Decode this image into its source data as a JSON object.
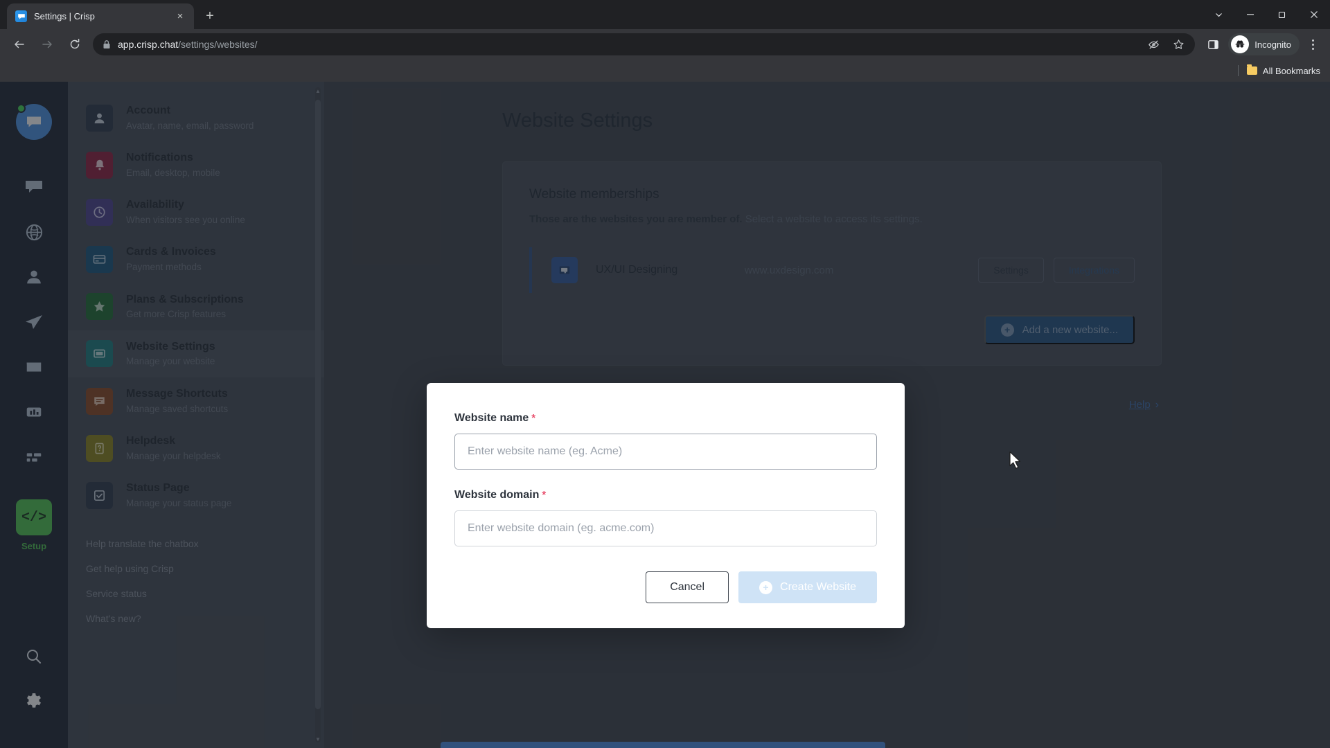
{
  "browser": {
    "tab": {
      "title": "Settings | Crisp",
      "favicon": "crisp-chat-icon",
      "close": "×"
    },
    "new_tab_label": "+",
    "window_controls": [
      "chevron-down-icon",
      "minimize-icon",
      "restore-icon",
      "close-icon"
    ],
    "nav": {
      "back": "back-arrow-icon",
      "forward": "forward-arrow-icon",
      "reload": "reload-icon"
    },
    "omnibox": {
      "lock": "lock-icon",
      "url_host": "app.crisp.chat",
      "url_path": "/settings/websites/",
      "actions": [
        "hide-password-icon",
        "bookmark-star-icon"
      ]
    },
    "side_panel_icon": "side-panel-icon",
    "profile": {
      "label": "Incognito",
      "icon": "incognito-icon"
    },
    "menu": "kebab-menu-icon",
    "bookmarks": {
      "label": "All Bookmarks",
      "icon": "folder-icon"
    }
  },
  "rail": {
    "avatar": {
      "name": "user-avatar",
      "status": "online"
    },
    "items": [
      {
        "name": "chat-icon"
      },
      {
        "name": "globe-icon"
      },
      {
        "name": "contacts-icon"
      },
      {
        "name": "campaigns-icon"
      },
      {
        "name": "helpdesk-folder-icon"
      },
      {
        "name": "analytics-icon"
      },
      {
        "name": "plugins-grid-icon"
      }
    ],
    "setup": {
      "label": "Setup",
      "icon": "code-brackets-icon"
    },
    "bottom": [
      {
        "name": "search-icon"
      },
      {
        "name": "settings-gear-icon"
      }
    ]
  },
  "sidepanel": {
    "items": [
      {
        "title": "Account",
        "subtitle": "Avatar, name, email, password",
        "icon": "person-icon",
        "color": "#2b3648",
        "active": false
      },
      {
        "title": "Notifications",
        "subtitle": "Email, desktop, mobile",
        "icon": "bell-icon",
        "color": "#8e1c3d",
        "active": false
      },
      {
        "title": "Availability",
        "subtitle": "When visitors see you online",
        "icon": "clock-icon",
        "color": "#4a3f8c",
        "active": false
      },
      {
        "title": "Cards & Invoices",
        "subtitle": "Payment methods",
        "icon": "credit-card-icon",
        "color": "#17527a",
        "active": false
      },
      {
        "title": "Plans & Subscriptions",
        "subtitle": "Get more Crisp features",
        "icon": "star-icon",
        "color": "#1d6b32",
        "active": false
      },
      {
        "title": "Website Settings",
        "subtitle": "Manage your website",
        "icon": "monitor-icon",
        "color": "#1a7a7d",
        "active": true
      },
      {
        "title": "Message Shortcuts",
        "subtitle": "Manage saved shortcuts",
        "icon": "message-lines-icon",
        "color": "#8a4521",
        "active": false
      },
      {
        "title": "Helpdesk",
        "subtitle": "Manage your helpdesk",
        "icon": "question-doc-icon",
        "color": "#8a8119",
        "active": false
      },
      {
        "title": "Status Page",
        "subtitle": "Manage your status page",
        "icon": "check-square-icon",
        "color": "#2b3648",
        "active": false
      }
    ],
    "links": [
      "Help translate the chatbox",
      "Get help using Crisp",
      "Service status",
      "What's new?"
    ],
    "scrollbar": {
      "up": "▲",
      "down": "▼"
    }
  },
  "main": {
    "page_title": "Website Settings",
    "card": {
      "heading": "Website memberships",
      "sub_strong": "Those are the websites you are member of.",
      "sub_rest": " Select a website to access its settings.",
      "website": {
        "icon": "website-monitor-icon",
        "name": "UX/UI Designing",
        "domain": "www.uxdesign.com",
        "settings_button": "Settings",
        "integrations_button": "Integrations"
      },
      "add_button": {
        "label": "Add a new website...",
        "icon": "plus-circle-icon"
      },
      "help": {
        "label": "Help",
        "chevron": "›"
      }
    }
  },
  "modal": {
    "name_field": {
      "label": "Website name",
      "required_mark": "*",
      "placeholder": "Enter website name (eg. Acme)",
      "value": ""
    },
    "domain_field": {
      "label": "Website domain",
      "required_mark": "*",
      "placeholder": "Enter website domain (eg. acme.com)",
      "value": ""
    },
    "cancel_button": "Cancel",
    "create_button": {
      "label": "Create Website",
      "icon": "plus-circle-icon"
    }
  },
  "colors": {
    "brand_blue": "#4a90e2",
    "accent_green": "#4fc34f",
    "required_red": "#e8506e",
    "rail_bg": "#1e2532",
    "panel_bg": "#444a54",
    "page_bg": "#3c4149"
  }
}
